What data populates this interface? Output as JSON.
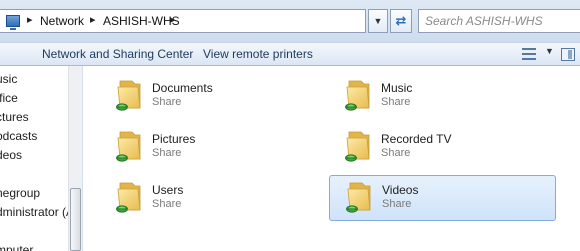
{
  "address_bar": {
    "breadcrumbs": [
      "Network",
      "ASHISH-WHS"
    ]
  },
  "search": {
    "placeholder": "Search ASHISH-WHS"
  },
  "toolbar": {
    "network_sharing_label": "Network and Sharing Center",
    "remote_printers_label": "View remote printers"
  },
  "nav_pane": {
    "items": [
      "usic",
      "ffice",
      "ctures",
      "odcasts",
      "deos",
      "negroup",
      "dministrator (A",
      "mputer"
    ]
  },
  "shares": [
    {
      "name": "Documents",
      "type": "Share"
    },
    {
      "name": "Music",
      "type": "Share"
    },
    {
      "name": "Pictures",
      "type": "Share"
    },
    {
      "name": "Recorded TV",
      "type": "Share"
    },
    {
      "name": "Users",
      "type": "Share"
    },
    {
      "name": "Videos",
      "type": "Share"
    }
  ],
  "colors": {
    "selection_fill": "#cfe3f9",
    "selection_border": "#84acdd",
    "toolbar_text": "#1e395b"
  }
}
